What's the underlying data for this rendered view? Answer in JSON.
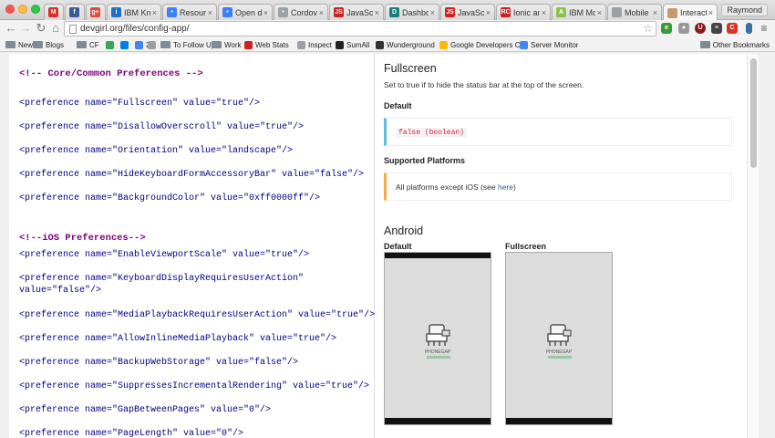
{
  "browser": {
    "tabs": [
      {
        "label": "",
        "favicon": "gmail-icon",
        "color": "#d93025",
        "letter": "M"
      },
      {
        "label": "",
        "favicon": "facebook-icon",
        "color": "#3b5998",
        "letter": "f"
      },
      {
        "label": "",
        "favicon": "google-plus-icon",
        "color": "#dd4b39",
        "letter": "g+"
      },
      {
        "label": "IBM Know",
        "favicon": "ibm-icon",
        "color": "#1f70c1",
        "letter": "i"
      },
      {
        "label": "Resource",
        "favicon": "globe-icon",
        "color": "#3b82f6",
        "letter": "•"
      },
      {
        "label": "Open disc",
        "favicon": "globe-icon",
        "color": "#3b82f6",
        "letter": "•"
      },
      {
        "label": "Cordova",
        "favicon": "globe-icon",
        "color": "#9aa0a6",
        "letter": "•"
      },
      {
        "label": "JavaScrip",
        "favicon": "javascript-icon",
        "color": "#cc2222",
        "letter": "JS"
      },
      {
        "label": "Dashboa",
        "favicon": "dashboard-icon",
        "color": "#1a7e7e",
        "letter": "D"
      },
      {
        "label": "JavaScrip",
        "favicon": "javascript-icon",
        "color": "#cc2222",
        "letter": "JS"
      },
      {
        "label": "Ionic and",
        "favicon": "rc-icon",
        "color": "#cc2222",
        "letter": "RC"
      },
      {
        "label": "IBM Mob",
        "favicon": "android-icon",
        "color": "#8bc34a",
        "letter": "A"
      },
      {
        "label": "Mobile Bl",
        "favicon": "document-icon",
        "color": "#9aa0a6",
        "letter": ""
      },
      {
        "label": "Interactive",
        "favicon": "devgirl-icon",
        "color": "#c59a6d",
        "letter": ""
      }
    ],
    "profile_name": "Raymond",
    "url": "devgirl.org/files/config-app/",
    "bookmarks": [
      {
        "label": "News",
        "type": "folder"
      },
      {
        "label": "Blogs",
        "type": "folder"
      },
      {
        "label": "CF",
        "type": "folder"
      },
      {
        "label": "",
        "type": "icon",
        "icon": "drive-icon",
        "color": "#34a853"
      },
      {
        "label": "",
        "type": "icon",
        "icon": "dropbox-icon",
        "color": "#007ee5"
      },
      {
        "label": "22",
        "type": "icon",
        "icon": "calendar-icon",
        "color": "#4285f4"
      },
      {
        "label": "",
        "type": "icon",
        "icon": "page-icon",
        "color": "#9aa0a6"
      },
      {
        "label": "To Follow Up",
        "type": "folder"
      },
      {
        "label": "Work",
        "type": "folder"
      },
      {
        "label": "Web Stats",
        "type": "icon",
        "icon": "rc-icon",
        "color": "#cc2222"
      },
      {
        "label": "Inspect",
        "type": "icon",
        "icon": "page-icon",
        "color": "#9aa0a6"
      },
      {
        "label": "SumAll",
        "type": "icon",
        "icon": "sumall-icon",
        "color": "#222222"
      },
      {
        "label": "Wunderground",
        "type": "icon",
        "icon": "wunderground-icon",
        "color": "#333333"
      },
      {
        "label": "Google Developers C",
        "type": "icon",
        "icon": "google-developers-icon",
        "color": "#fbbc05"
      },
      {
        "label": "Server Monitor",
        "type": "icon",
        "icon": "server-monitor-icon",
        "color": "#4285f4"
      }
    ],
    "other_bookmarks": "Other Bookmarks"
  },
  "code_panel": {
    "lines": [
      {
        "text": "<!-- Core/Common Preferences -->",
        "kind": "comment"
      },
      {
        "text": "<preference name=\"Fullscreen\" value=\"true\"/>",
        "kind": "code"
      },
      {
        "text": "<preference name=\"DisallowOverscroll\" value=\"true\"/>",
        "kind": "code"
      },
      {
        "text": "<preference name=\"Orientation\" value=\"landscape\"/>",
        "kind": "code"
      },
      {
        "text": "<preference name=\"HideKeyboardFormAccessoryBar\" value=\"false\"/>",
        "kind": "code"
      },
      {
        "text": "<preference name=\"BackgroundColor\" value=\"0xff0000ff\"/>",
        "kind": "code"
      },
      {
        "text": "<!--iOS Preferences-->",
        "kind": "comment"
      },
      {
        "text": "<preference name=\"EnableViewportScale\" value=\"true\"/>",
        "kind": "code"
      },
      {
        "text": "<preference name=\"KeyboardDisplayRequiresUserAction\"\nvalue=\"false\"/>",
        "kind": "code"
      },
      {
        "text": "<preference name=\"MediaPlaybackRequiresUserAction\" value=\"true\"/>",
        "kind": "code"
      },
      {
        "text": "<preference name=\"AllowInlineMediaPlayback\" value=\"true\"/>",
        "kind": "code"
      },
      {
        "text": "<preference name=\"BackupWebStorage\" value=\"false\"/>",
        "kind": "code"
      },
      {
        "text": "<preference name=\"SuppressesIncrementalRendering\" value=\"true\"/>",
        "kind": "code"
      },
      {
        "text": "<preference name=\"GapBetweenPages\" value=\"0\"/>",
        "kind": "code"
      },
      {
        "text": "<preference name=\"PageLength\" value=\"0\"/>",
        "kind": "code"
      }
    ]
  },
  "doc_panel": {
    "title": "Fullscreen",
    "description": "Set to true if to hide the status bar at the top of the screen.",
    "default_heading": "Default",
    "default_value": "false (boolean)",
    "platforms_heading": "Supported Platforms",
    "platforms_text": "All platforms except iOS (see ",
    "platforms_link": "here",
    "platforms_close": ")",
    "android_heading": "Android",
    "screens": [
      {
        "label": "Default",
        "app_name": "PHONEGAP"
      },
      {
        "label": "Fullscreen",
        "app_name": "PHONEGAP"
      }
    ]
  }
}
